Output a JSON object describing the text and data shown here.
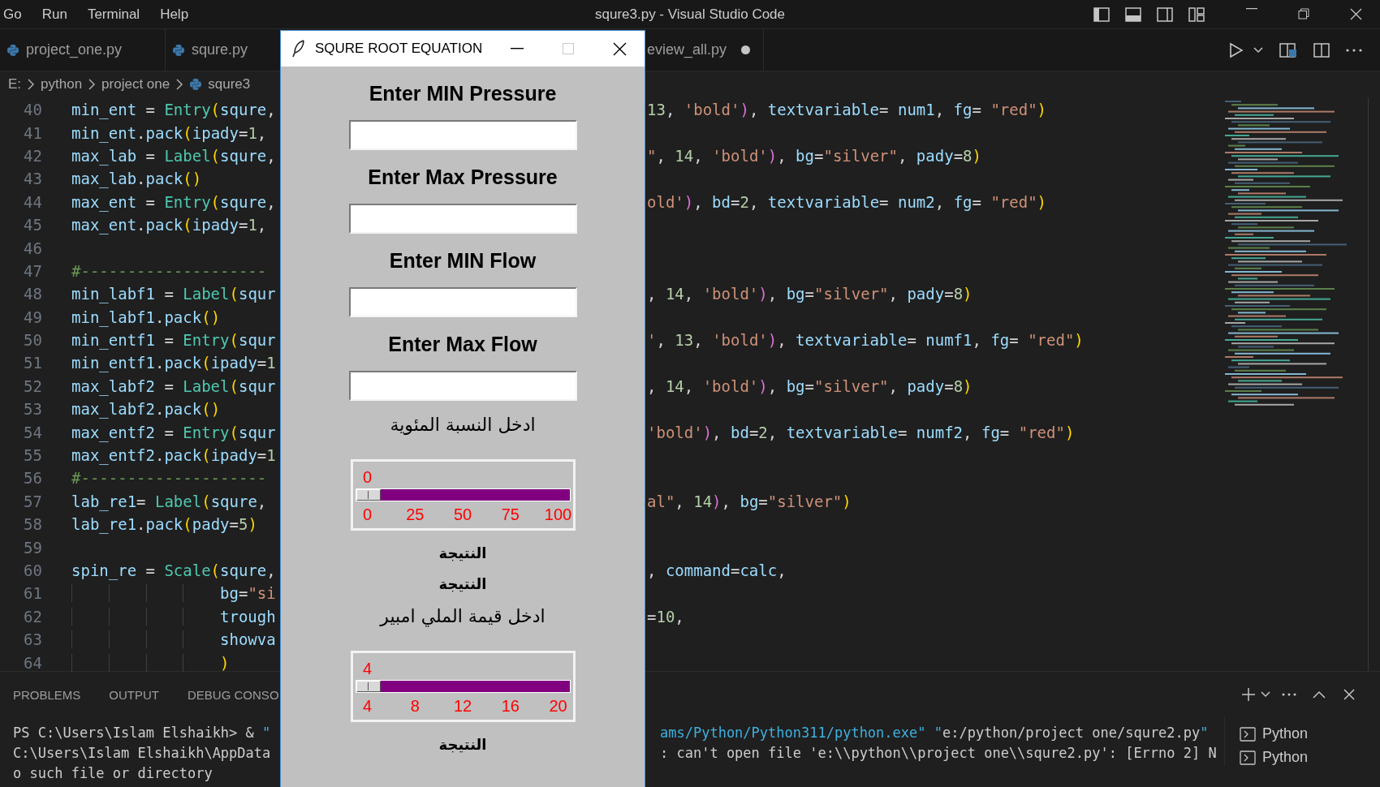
{
  "menu": [
    "Go",
    "Run",
    "Terminal",
    "Help"
  ],
  "window": {
    "title": "squre3.py - Visual Studio Code"
  },
  "tabs": [
    {
      "label": "project_one.py",
      "modified": false
    },
    {
      "label": "squre.py",
      "modified": false
    },
    {
      "label": "eview_all.py",
      "modified": true
    }
  ],
  "breadcrumb": [
    "E:",
    "python",
    "project one",
    "squre3"
  ],
  "code": [
    {
      "n": "40",
      "left": "min_ent = Entry(squre,",
      "right": "13, 'bold'), textvariable= num1, fg= \"red\")"
    },
    {
      "n": "41",
      "left": "min_ent.pack(ipady=1,"
    },
    {
      "n": "42",
      "left": "max_lab = Label(squre,",
      "right": "\", 14, 'bold'), bg=\"silver\", pady=8)"
    },
    {
      "n": "43",
      "left": "max_lab.pack()"
    },
    {
      "n": "44",
      "left": "max_ent = Entry(squre,",
      "right": "old'), bd=2, textvariable= num2, fg= \"red\")"
    },
    {
      "n": "45",
      "left": "max_ent.pack(ipady=1,"
    },
    {
      "n": "46"
    },
    {
      "n": "47",
      "left": "#--------------------"
    },
    {
      "n": "48",
      "left": "min_labf1 = Label(squr",
      "right": ", 14, 'bold'), bg=\"silver\", pady=8)"
    },
    {
      "n": "49",
      "left": "min_labf1.pack()"
    },
    {
      "n": "50",
      "left": "min_entf1 = Entry(squr",
      "right": "', 13, 'bold'), textvariable= numf1, fg= \"red\")"
    },
    {
      "n": "51",
      "left": "min_entf1.pack(ipady=1"
    },
    {
      "n": "52",
      "left": "max_labf2 = Label(squr",
      "right": ", 14, 'bold'), bg=\"silver\", pady=8)"
    },
    {
      "n": "53",
      "left": "max_labf2.pack()"
    },
    {
      "n": "54",
      "left": "max_entf2 = Entry(squr",
      "right": "'bold'), bd=2, textvariable= numf2, fg= \"red\")"
    },
    {
      "n": "55",
      "left": "max_entf2.pack(ipady=1"
    },
    {
      "n": "56",
      "left": "#--------------------"
    },
    {
      "n": "57",
      "left": "lab_re1= Label(squre,",
      "right": "al\", 14), bg=\"silver\")"
    },
    {
      "n": "58",
      "left": "lab_re1.pack(pady=5)"
    },
    {
      "n": "59"
    },
    {
      "n": "60",
      "left": "spin_re = Scale(squre,",
      "right": ", command=calc,"
    },
    {
      "n": "61",
      "left": "                bg=\"si"
    },
    {
      "n": "62",
      "left": "                trough",
      "right": "=10,"
    },
    {
      "n": "63",
      "left": "                showva"
    },
    {
      "n": "64",
      "left": "                )"
    }
  ],
  "panel": {
    "tabs": [
      "PROBLEMS",
      "OUTPUT",
      "DEBUG CONSO"
    ],
    "terminal": [
      {
        "left": "PS C:\\Users\\Islam Elshaikh> & \"",
        "right": "ams/Python/Python311/python.exe\" \"e:/python/project one/squre2.py\""
      },
      {
        "left": "C:\\Users\\Islam Elshaikh\\AppData",
        "right": ": can't open file 'e:\\\\python\\\\project one\\\\squre2.py': [Errno 2] N"
      },
      {
        "left": "o such file or directory"
      }
    ],
    "terminals": [
      "Python",
      "Python"
    ]
  },
  "tk_window": {
    "title": "SQURE ROOT EQUATION",
    "widgets": [
      {
        "kind": "heading",
        "text": "Enter MIN Pressure"
      },
      {
        "kind": "entry"
      },
      {
        "kind": "heading",
        "text": "Enter Max Pressure"
      },
      {
        "kind": "entry"
      },
      {
        "kind": "heading",
        "text": "Enter MIN Flow"
      },
      {
        "kind": "entry"
      },
      {
        "kind": "heading",
        "text": "Enter Max Flow"
      },
      {
        "kind": "entry"
      },
      {
        "kind": "label",
        "text": "ادخل النسبة المئوية"
      },
      {
        "kind": "scale",
        "value": "0",
        "ticks": [
          "0",
          "25",
          "50",
          "75",
          "100"
        ],
        "level": 0
      },
      {
        "kind": "result",
        "text": "النتيجة"
      },
      {
        "kind": "result",
        "text": "النتيجة"
      },
      {
        "kind": "label",
        "text": "ادخل قيمة الملي امبير"
      },
      {
        "kind": "scale",
        "value": "4",
        "ticks": [
          "4",
          "8",
          "12",
          "16",
          "20"
        ],
        "level": 0
      },
      {
        "kind": "result",
        "text": "النتيجة"
      }
    ]
  }
}
